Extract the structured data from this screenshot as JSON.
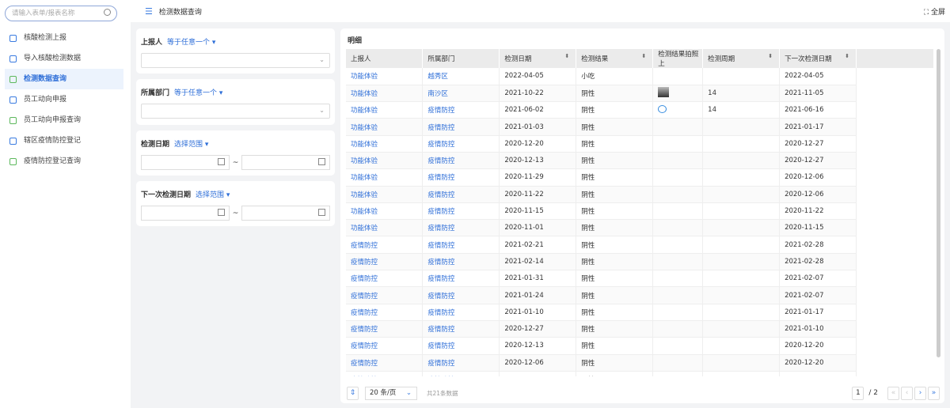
{
  "sidebar": {
    "search_placeholder": "请输入表单/报表名称",
    "items": [
      {
        "label": "核酸检测上报",
        "color": "#3a7be0"
      },
      {
        "label": "导入核酸检测数据",
        "color": "#3a7be0"
      },
      {
        "label": "检测数据查询",
        "color": "#5cb85c",
        "active": true
      },
      {
        "label": "员工动向申报",
        "color": "#3a7be0"
      },
      {
        "label": "员工动向申报查询",
        "color": "#5cb85c"
      },
      {
        "label": "辖区疫情防控登记",
        "color": "#3a7be0"
      },
      {
        "label": "疫情防控登记查询",
        "color": "#5cb85c"
      }
    ]
  },
  "topbar": {
    "title": "检测数据查询",
    "fullscreen": "全屏"
  },
  "filters": [
    {
      "label": "上报人",
      "op": "等于任意一个"
    },
    {
      "label": "所属部门",
      "op": "等于任意一个"
    },
    {
      "label": "检测日期",
      "op": "选择范围",
      "range_sep": "~"
    },
    {
      "label": "下一次检测日期",
      "op": "选择范围",
      "range_sep": "~"
    }
  ],
  "table": {
    "title": "明细",
    "columns": [
      "上报人",
      "所属部门",
      "检测日期",
      "检测结果",
      "检测结果拍照上",
      "检测周期",
      "下一次检测日期"
    ],
    "rows": [
      [
        "功能体验",
        "越秀区",
        "2022-04-05",
        "小吃",
        "",
        "",
        "2022-04-05"
      ],
      [
        "功能体验",
        "南沙区",
        "2021-10-22",
        "阴性",
        "thumb",
        "14",
        "2021-11-05"
      ],
      [
        "功能体验",
        "疫情防控",
        "2021-06-02",
        "阴性",
        "bubble",
        "14",
        "2021-06-16"
      ],
      [
        "功能体验",
        "疫情防控",
        "2021-01-03",
        "阴性",
        "",
        "",
        "2021-01-17"
      ],
      [
        "功能体验",
        "疫情防控",
        "2020-12-20",
        "阴性",
        "",
        "",
        "2020-12-27"
      ],
      [
        "功能体验",
        "疫情防控",
        "2020-12-13",
        "阴性",
        "",
        "",
        "2020-12-27"
      ],
      [
        "功能体验",
        "疫情防控",
        "2020-11-29",
        "阴性",
        "",
        "",
        "2020-12-06"
      ],
      [
        "功能体验",
        "疫情防控",
        "2020-11-22",
        "阴性",
        "",
        "",
        "2020-12-06"
      ],
      [
        "功能体验",
        "疫情防控",
        "2020-11-15",
        "阴性",
        "",
        "",
        "2020-11-22"
      ],
      [
        "功能体验",
        "疫情防控",
        "2020-11-01",
        "阴性",
        "",
        "",
        "2020-11-15"
      ],
      [
        "疫情防控",
        "疫情防控",
        "2021-02-21",
        "阴性",
        "",
        "",
        "2021-02-28"
      ],
      [
        "疫情防控",
        "疫情防控",
        "2021-02-14",
        "阴性",
        "",
        "",
        "2021-02-28"
      ],
      [
        "疫情防控",
        "疫情防控",
        "2021-01-31",
        "阴性",
        "",
        "",
        "2021-02-07"
      ],
      [
        "疫情防控",
        "疫情防控",
        "2021-01-24",
        "阴性",
        "",
        "",
        "2021-02-07"
      ],
      [
        "疫情防控",
        "疫情防控",
        "2021-01-10",
        "阴性",
        "",
        "",
        "2021-01-17"
      ],
      [
        "疫情防控",
        "疫情防控",
        "2020-12-27",
        "阴性",
        "",
        "",
        "2021-01-10"
      ],
      [
        "疫情防控",
        "疫情防控",
        "2020-12-13",
        "阴性",
        "",
        "",
        "2020-12-20"
      ],
      [
        "疫情防控",
        "疫情防控",
        "2020-12-06",
        "阴性",
        "",
        "",
        "2020-12-20"
      ],
      [
        "疫情防控",
        "疫情防控",
        "",
        "阴性",
        "",
        "",
        ""
      ]
    ]
  },
  "pagination": {
    "page_size": "20 条/页",
    "total": "共21条数据",
    "current": "1",
    "pages": "/ 2"
  }
}
